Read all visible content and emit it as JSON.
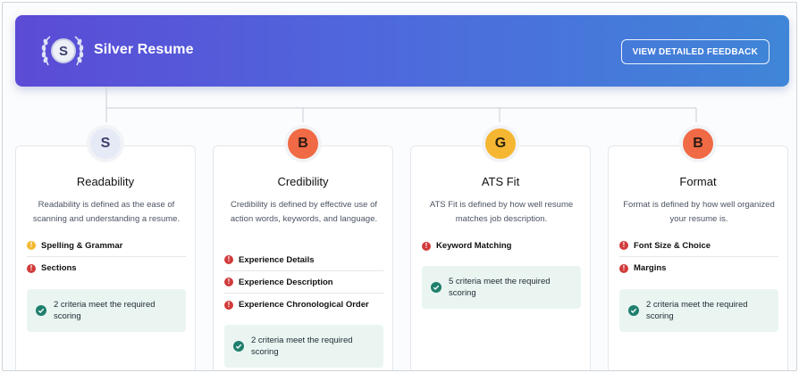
{
  "header": {
    "badge_letter": "S",
    "title": "Silver Resume",
    "feedback_button": "VIEW DETAILED FEEDBACK"
  },
  "colors": {
    "header_gradient_start": "#5b4bd6",
    "header_gradient_end": "#3f86d8",
    "grade_s": "#e6e9f6",
    "grade_b": "#f06a45",
    "grade_g": "#f5b731",
    "issue_red": "#d23b3b",
    "warning_yellow": "#f2b92f",
    "success_green": "#1f7f6d"
  },
  "cards": [
    {
      "grade": "S",
      "title": "Readability",
      "description": "Readability is defined as the ease of scanning and understanding a resume.",
      "criteria": [
        {
          "label": "Spelling & Grammar",
          "status": "warning"
        },
        {
          "label": "Sections",
          "status": "issue"
        }
      ],
      "meet_text": "2 criteria meet the required scoring"
    },
    {
      "grade": "B",
      "title": "Credibility",
      "description": "Credibility is defined by effective use of action words, keywords, and language.",
      "criteria": [
        {
          "label": "Experience Details",
          "status": "issue"
        },
        {
          "label": "Experience Description",
          "status": "issue"
        },
        {
          "label": "Experience Chronological Order",
          "status": "issue"
        }
      ],
      "meet_text": "2 criteria meet the required scoring"
    },
    {
      "grade": "G",
      "title": "ATS Fit",
      "description": "ATS Fit is defined by how well resume matches job description.",
      "criteria": [
        {
          "label": "Keyword Matching",
          "status": "issue"
        }
      ],
      "meet_text": "5 criteria meet the required scoring"
    },
    {
      "grade": "B",
      "title": "Format",
      "description": "Format is defined by how well organized your resume is.",
      "criteria": [
        {
          "label": "Font Size & Choice",
          "status": "issue"
        },
        {
          "label": "Margins",
          "status": "issue"
        }
      ],
      "meet_text": "2 criteria meet the required scoring"
    }
  ]
}
